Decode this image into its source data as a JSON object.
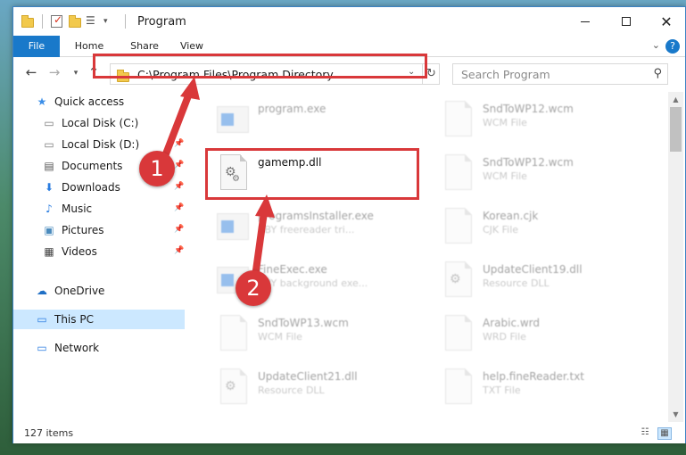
{
  "window": {
    "title": "Program"
  },
  "ribbon": {
    "tabs": [
      "File",
      "Home",
      "Share",
      "View"
    ],
    "help": "?"
  },
  "address": {
    "path": "C:\\Program Files\\Program Directory"
  },
  "search": {
    "placeholder": "Search Program"
  },
  "sidebar": {
    "items": [
      {
        "label": "Quick access",
        "icon": "star-icon",
        "pinned": false
      },
      {
        "label": "Local Disk (C:)",
        "icon": "drive-icon",
        "pinned": false
      },
      {
        "label": "Local Disk (D:)",
        "icon": "drive-icon",
        "pinned": true
      },
      {
        "label": "Documents",
        "icon": "documents-icon",
        "pinned": true
      },
      {
        "label": "Downloads",
        "icon": "download-icon",
        "pinned": true
      },
      {
        "label": "Music",
        "icon": "music-icon",
        "pinned": true
      },
      {
        "label": "Pictures",
        "icon": "pictures-icon",
        "pinned": true
      },
      {
        "label": "Videos",
        "icon": "videos-icon",
        "pinned": true
      },
      {
        "label": "OneDrive",
        "icon": "onedrive-icon",
        "pinned": false
      },
      {
        "label": "This PC",
        "icon": "pc-icon",
        "pinned": false,
        "selected": true
      },
      {
        "label": "Network",
        "icon": "network-icon",
        "pinned": false
      }
    ]
  },
  "files": [
    {
      "name": "program.exe",
      "type": "",
      "icon": "exe-icon"
    },
    {
      "name": "SndToWP12.wcm",
      "type": "WCM File",
      "icon": "file-icon"
    },
    {
      "name": "gamemp.dll",
      "type": "",
      "icon": "dll-icon"
    },
    {
      "name": "SndToWP12.wcm",
      "type": "WCM File",
      "icon": "file-icon"
    },
    {
      "name": "programsInstaller.exe",
      "type": "BBY freereader tri...",
      "icon": "exe-icon"
    },
    {
      "name": "Korean.cjk",
      "type": "CJK File",
      "icon": "file-icon"
    },
    {
      "name": "FineExec.exe",
      "type": "BBY background exe...",
      "icon": "exe-icon"
    },
    {
      "name": "UpdateClient19.dll",
      "type": "Resource DLL",
      "icon": "dll-icon"
    },
    {
      "name": "SndToWP13.wcm",
      "type": "WCM File",
      "icon": "file-icon"
    },
    {
      "name": "Arabic.wrd",
      "type": "WRD File",
      "icon": "file-icon"
    },
    {
      "name": "UpdateClient21.dll",
      "type": "Resource DLL",
      "icon": "dll-icon"
    },
    {
      "name": "help.fineReader.txt",
      "type": "TXT File",
      "icon": "txt-icon"
    }
  ],
  "status": {
    "count": "127 items"
  },
  "annotations": {
    "step1": "1",
    "step2": "2"
  },
  "colors": {
    "accent": "#1979ca",
    "highlight": "#d9383a",
    "selected": "#cce8ff"
  }
}
